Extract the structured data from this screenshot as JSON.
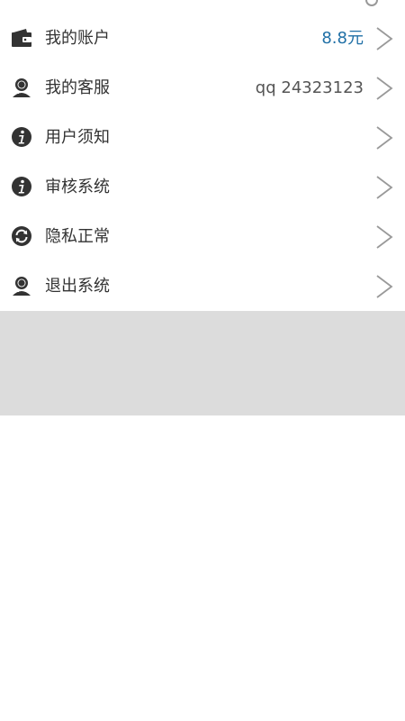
{
  "menu": {
    "items": [
      {
        "label": "我的账户",
        "value": "8.8元",
        "icon": "wallet-icon",
        "value_color": "#1f6fa6"
      },
      {
        "label": "我的客服",
        "value": "qq 24323123",
        "icon": "customer-service-icon"
      },
      {
        "label": "用户须知",
        "value": "",
        "icon": "info-icon"
      },
      {
        "label": "审核系统",
        "value": "",
        "icon": "info-icon"
      },
      {
        "label": "隐私正常",
        "value": "",
        "icon": "refresh-icon"
      },
      {
        "label": "退出系统",
        "value": "",
        "icon": "user-icon"
      }
    ]
  },
  "colors": {
    "background": "#ffffff",
    "divider_block": "#dcdcdc",
    "text": "#333333",
    "accent": "#1f6fa6",
    "chevron": "#999999"
  }
}
